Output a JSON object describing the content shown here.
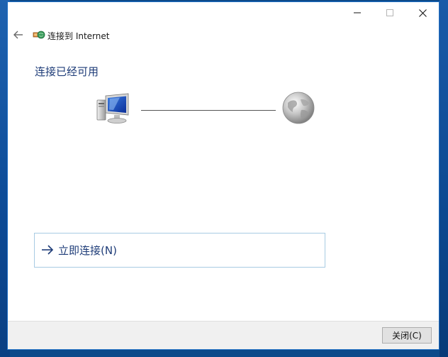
{
  "window": {
    "controls": {
      "minimize": "—",
      "maximize": "☐",
      "close": "✕"
    }
  },
  "header": {
    "back_icon": "back-arrow-icon",
    "network_icon": "network-connection-icon",
    "title": "连接到 Internet"
  },
  "main": {
    "heading": "连接已经可用",
    "diagram": {
      "left_icon": "computer-icon",
      "right_icon": "globe-icon"
    },
    "connect_option": {
      "icon": "arrow-right-icon",
      "label": "立即连接(N)"
    }
  },
  "footer": {
    "close_label": "关闭(C)"
  },
  "colors": {
    "heading": "#1e3c78",
    "option_border": "#a8cbe3",
    "window_border": "#1f6fc4"
  }
}
